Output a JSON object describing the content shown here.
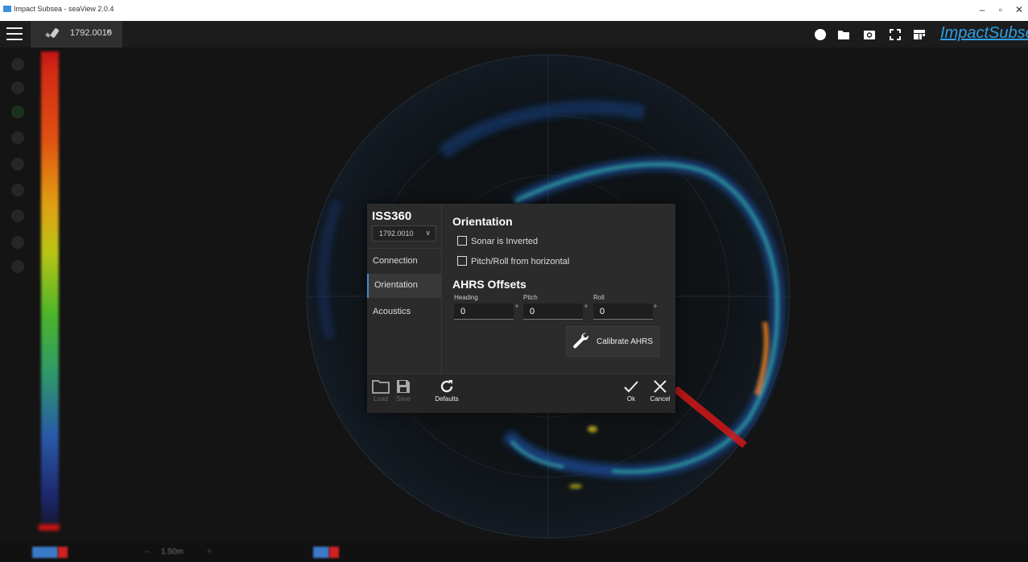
{
  "window": {
    "title": "Impact Subsea - seaView 2.0.4",
    "minimize": "–",
    "restore": "▫",
    "close": "✕"
  },
  "tab": {
    "label": "1792.0010",
    "close": "×"
  },
  "toolbar": {
    "icons": [
      "record-icon",
      "folder-icon",
      "camera-icon",
      "fullscreen-icon",
      "layout-icon"
    ],
    "brand": "ImpactSubsea"
  },
  "bottom": {
    "range": "1.50m",
    "minus": "–",
    "plus": "+"
  },
  "dialog": {
    "device_title": "ISS360",
    "device_select": "1792.0010",
    "nav": [
      "Connection",
      "Orientation",
      "Acoustics"
    ],
    "active_nav": "Orientation",
    "orientation_title": "Orientation",
    "sonar_inverted_label": "Sonar is Inverted",
    "sonar_inverted_checked": false,
    "pitch_roll_label": "Pitch/Roll from horizontal",
    "pitch_roll_checked": false,
    "ahrs_title": "AHRS Offsets",
    "heading_label": "Heading",
    "heading_value": "0",
    "pitch_label": "Pitch",
    "pitch_value": "0",
    "roll_label": "Roll",
    "roll_value": "0",
    "degree_unit": "°",
    "calibrate_label": "Calibrate AHRS",
    "footer": {
      "load": "Load",
      "save": "Save",
      "defaults": "Defaults",
      "ok": "Ok",
      "cancel": "Cancel"
    }
  },
  "colors": {
    "accent": "#3a8fd8",
    "brand": "#2f9fe6",
    "dialog_bg": "#2b2b2b",
    "background": "#141414"
  }
}
